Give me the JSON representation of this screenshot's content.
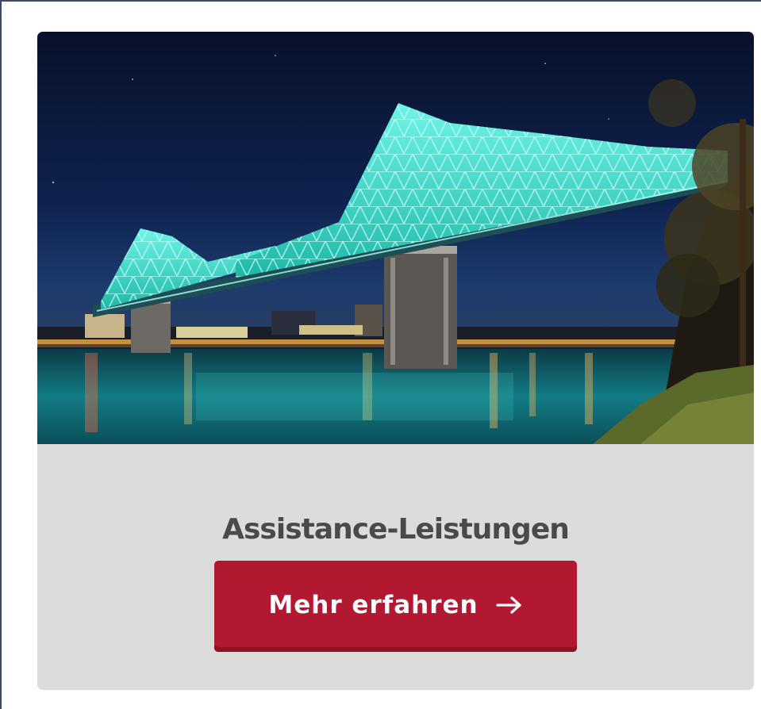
{
  "card": {
    "image_alt": "Illuminated bridge at night over a river",
    "title": "Assistance-Leistungen",
    "button_label": "Mehr erfahren",
    "button_icon": "arrow-right-icon"
  },
  "colors": {
    "card_background": "#dcdcdc",
    "title_text": "#4a4a4a",
    "button_background": "#b2182f",
    "button_text": "#ffffff",
    "bridge_light": "#3fe0cf",
    "night_sky": "#0c1a3a"
  }
}
